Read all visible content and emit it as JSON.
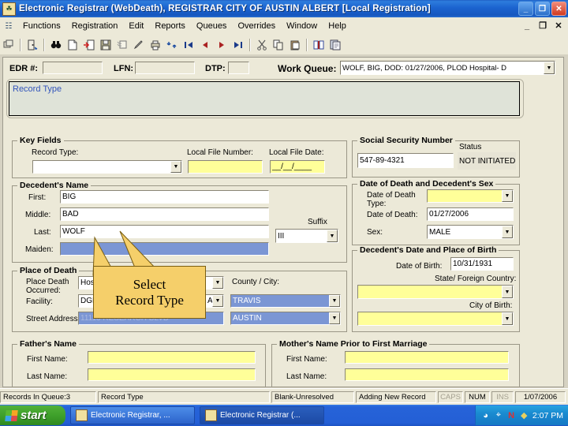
{
  "window": {
    "title": "Electronic Registrar (WebDeath), REGISTRAR   CITY OF AUSTIN   ALBERT   [Local Registration]",
    "icon": "app-icon",
    "minimize": "_",
    "restore": "❐",
    "close": "✕"
  },
  "mdi_controls": {
    "minimize": "_",
    "restore": "❐",
    "close": "✕"
  },
  "menubar": {
    "system_icon": "system-menu-icon",
    "items": [
      {
        "label": "Functions"
      },
      {
        "label": "Registration"
      },
      {
        "label": "Edit"
      },
      {
        "label": "Reports"
      },
      {
        "label": "Queues"
      },
      {
        "label": "Overrides"
      },
      {
        "label": "Window"
      },
      {
        "label": "Help"
      }
    ]
  },
  "toolbar": {
    "buttons": [
      {
        "name": "tile-windows-icon"
      },
      {
        "name": "exit-door-icon"
      },
      {
        "name": "find-binoculars-icon"
      },
      {
        "name": "new-document-icon"
      },
      {
        "name": "insert-record-icon"
      },
      {
        "name": "save-disk-icon"
      },
      {
        "name": "delete-record-icon"
      },
      {
        "name": "edit-pencil-icon"
      },
      {
        "name": "print-icon"
      },
      {
        "name": "refresh-icon"
      },
      {
        "name": "first-record-icon"
      },
      {
        "name": "previous-record-icon"
      },
      {
        "name": "next-record-icon"
      },
      {
        "name": "last-record-icon"
      },
      {
        "name": "cut-scissors-icon"
      },
      {
        "name": "copy-icon"
      },
      {
        "name": "paste-icon"
      },
      {
        "name": "book-icon"
      },
      {
        "name": "reports-icon"
      }
    ]
  },
  "header": {
    "edr_label": "EDR #:",
    "edr_value": "",
    "lfn_label": "LFN:",
    "lfn_value": "",
    "dtp_label": "DTP:",
    "dtp_value": "",
    "work_queue_label": "Work Queue:",
    "work_queue_value": "WOLF, BIG, DOD: 01/27/2006, PLOD  Hospital- D"
  },
  "banner": {
    "text": "Record Type"
  },
  "key_fields": {
    "title": "Key Fields",
    "record_type_label": "Record Type:",
    "record_type_value": "",
    "local_file_number_label": "Local File Number:",
    "local_file_number_value": "",
    "local_file_date_label": "Local File Date:",
    "local_file_date_value": "__/__/____"
  },
  "decedent_name": {
    "title": "Decedent's Name",
    "first_label": "First:",
    "first_value": "BIG",
    "middle_label": "Middle:",
    "middle_value": "BAD",
    "last_label": "Last:",
    "last_value": "WOLF",
    "maiden_label": "Maiden:",
    "maiden_value": "",
    "suffix_label": "Suffix",
    "suffix_value": "III"
  },
  "place_of_death": {
    "title": "Place of Death",
    "place_death_label": "Place Death Occurred:",
    "place_death_value": "Hospital- Dead On Arrival",
    "facility_label": "Facility:",
    "facility_value": "DGHTRS OF CHTY HTH SVCS OF AUS",
    "street_label": "Street Address:",
    "street_value": "11113 RESEARCH BLVD",
    "county_city_label": "County / City:",
    "county_value": "TRAVIS",
    "city_value": "AUSTIN"
  },
  "ssn": {
    "title": "Social Security Number",
    "value": "547-89-4321",
    "status_label": "Status",
    "status_value": "NOT INITIATED"
  },
  "death_sex": {
    "title": "Date of Death and Decedent's Sex",
    "dod_type_label": "Date of Death Type:",
    "dod_type_value": "",
    "dod_label": "Date of Death:",
    "dod_value": "01/27/2006",
    "sex_label": "Sex:",
    "sex_value": "MALE"
  },
  "birth": {
    "title": "Decedent's Date and Place of Birth",
    "dob_label": "Date of Birth:",
    "dob_value": "10/31/1931",
    "state_label": "State/ Foreign Country:",
    "state_value": "",
    "city_label": "City of Birth:",
    "city_value": ""
  },
  "father": {
    "title": "Father's Name",
    "first_label": "First Name:",
    "first_value": "",
    "last_label": "Last Name:",
    "last_value": ""
  },
  "mother": {
    "title": "Mother's Name Prior to First Marriage",
    "first_label": "First Name:",
    "first_value": "",
    "last_label": "Last Name:",
    "last_value": ""
  },
  "callout": {
    "line1": "Select",
    "line2": "Record Type"
  },
  "statusbar": {
    "records_in_queue": "Records In Queue:3",
    "record_type": "Record Type",
    "resolution": "Blank-Unresolved",
    "mode": "Adding New Record",
    "caps": "CAPS",
    "num": "NUM",
    "ins": "INS",
    "date": "1/07/2006"
  },
  "taskbar": {
    "start_label": "start",
    "items": [
      {
        "label": "Electronic Registrar, ...",
        "icon": "app-icon"
      },
      {
        "label": "Electronic Registrar (...",
        "icon": "app-icon"
      }
    ],
    "tray": [
      {
        "name": "volume-icon",
        "glyph": "◕"
      },
      {
        "name": "network-icon",
        "glyph": "⌖"
      },
      {
        "name": "norton-icon",
        "glyph": "N"
      },
      {
        "name": "shield-icon",
        "glyph": "◆"
      }
    ],
    "time": "2:07 PM"
  },
  "colors": {
    "titlebar": "#1b63cf",
    "face": "#ece9d8",
    "required_field": "#ffff99",
    "selected_field": "#7b96d4",
    "callout": "#f5cf6a",
    "banner_text": "#3355bb"
  }
}
